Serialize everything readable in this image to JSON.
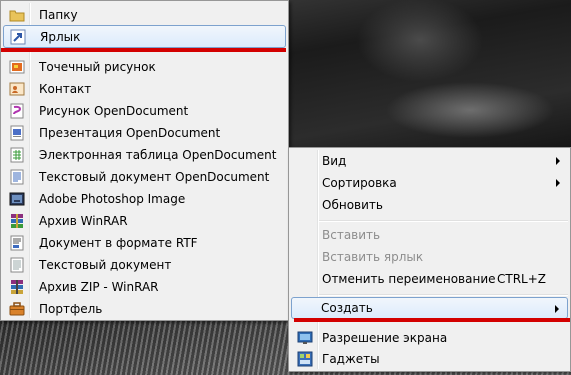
{
  "new_submenu": {
    "items": [
      {
        "label": "Папку",
        "icon": "folder-icon"
      },
      {
        "label": "Ярлык",
        "icon": "shortcut-icon"
      },
      {
        "label": "Точечный рисунок",
        "icon": "bitmap-icon"
      },
      {
        "label": "Контакт",
        "icon": "contact-icon"
      },
      {
        "label": "Рисунок OpenDocument",
        "icon": "odg-drawing-icon"
      },
      {
        "label": "Презентация OpenDocument",
        "icon": "odp-presentation-icon"
      },
      {
        "label": "Электронная таблица OpenDocument",
        "icon": "ods-spreadsheet-icon"
      },
      {
        "label": "Текстовый документ OpenDocument",
        "icon": "odt-text-icon"
      },
      {
        "label": "Adobe Photoshop Image",
        "icon": "photoshop-icon"
      },
      {
        "label": "Архив WinRAR",
        "icon": "winrar-icon"
      },
      {
        "label": "Документ в формате RTF",
        "icon": "rtf-document-icon"
      },
      {
        "label": "Текстовый документ",
        "icon": "text-document-icon"
      },
      {
        "label": "Архив ZIP - WinRAR",
        "icon": "zip-archive-icon"
      },
      {
        "label": "Портфель",
        "icon": "briefcase-icon"
      }
    ]
  },
  "context_menu": {
    "view": "Вид",
    "sort": "Сортировка",
    "refresh": "Обновить",
    "paste": "Вставить",
    "paste_shortcut": "Вставить ярлык",
    "undo_rename": "Отменить переименование",
    "undo_shortcut": "CTRL+Z",
    "create": "Создать",
    "screen_resolution": "Разрешение экрана",
    "gadgets": "Гаджеты"
  },
  "colors": {
    "highlight_underline": "#d30000",
    "menu_background": "#f0f0f0",
    "hover_border": "#7da2ce"
  }
}
